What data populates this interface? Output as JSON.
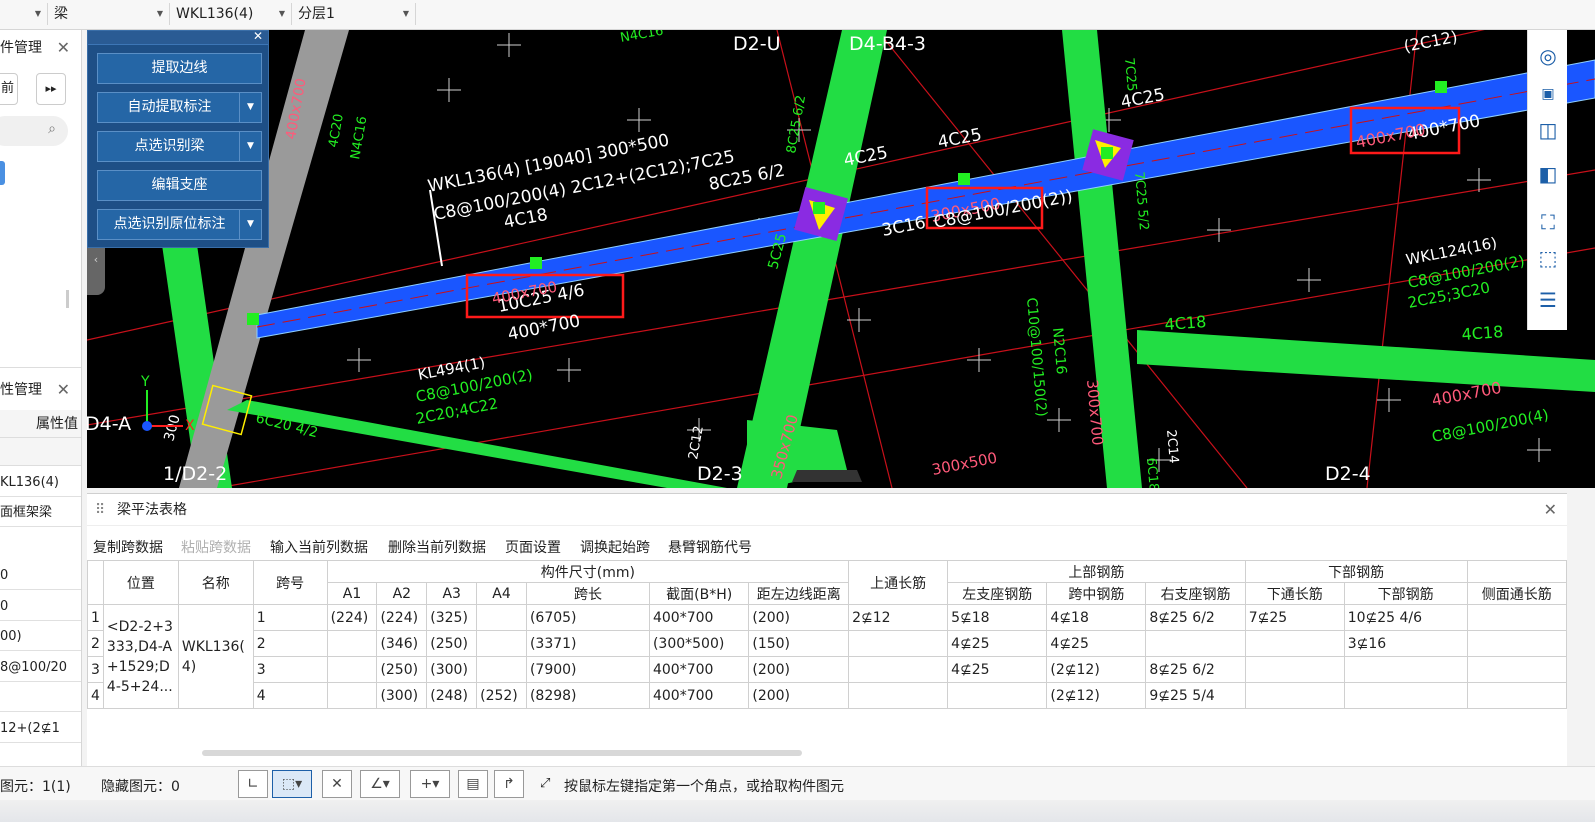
{
  "toolbar": {
    "combo1": "",
    "combo2": "梁",
    "combo3": "WKL136(4)",
    "combo4": "分层1"
  },
  "left_panel": {
    "panel1_title": "件管理",
    "panel1_btn": "前",
    "panel2_title": "性管理",
    "prop_header": "属性值",
    "rows": [
      "KL136(4)",
      "面框架梁",
      "0",
      "0",
      "00)",
      "8@100/20",
      "",
      "12+(2⊈1"
    ]
  },
  "float_tool": {
    "buttons": [
      "提取边线",
      "自动提取标注",
      "点选识别梁",
      "编辑支座",
      "点选识别原位标注"
    ]
  },
  "canvas": {
    "axis_labels": [
      "D2-U",
      "D4-B4-3",
      "D4-A",
      "1/D2-2",
      "D2-3",
      "D2-4"
    ],
    "annotations": [
      "WKL136(4) [19040] 300*500",
      "C8@100/200(4) 2C12+(2C12);7C25",
      "4C18",
      "8C25 6/2",
      "4C25",
      "4C25",
      "4C25",
      "(2C12)",
      "400*700",
      "400x700",
      "300x500",
      "C8@100/200(2))",
      "3C16",
      "10C25 4/6",
      "400*700",
      "400x700",
      "WKL124(16)",
      "C8@100/200(2)",
      "2C25;3C20",
      "KL494(1)",
      "C8@100/200(2)",
      "2C20;4C22",
      "4C18",
      "4C18",
      "400x700",
      "C8@100/200(4)",
      "300x500",
      "350x700",
      "5C25",
      "300x700",
      "C10@100/150(2)",
      "N2C16",
      "6C20 4/2",
      "400x700",
      "4C20",
      "N4C16",
      "N4C16",
      "2C14",
      "2C12",
      "6C18",
      "7C25",
      "7C25 5/2",
      "8C25 6/2",
      "300"
    ],
    "coord": [
      "Y",
      "X"
    ]
  },
  "table_panel": {
    "title": "梁平法表格",
    "toolbar": [
      {
        "label": "复制跨数据",
        "enabled": true
      },
      {
        "label": "粘贴跨数据",
        "enabled": false
      },
      {
        "label": "输入当前列数据",
        "enabled": true
      },
      {
        "label": "删除当前列数据",
        "enabled": true
      },
      {
        "label": "页面设置",
        "enabled": true
      },
      {
        "label": "调换起始跨",
        "enabled": true
      },
      {
        "label": "悬臂钢筋代号",
        "enabled": true
      }
    ],
    "group_headers": {
      "position": "位置",
      "name": "名称",
      "span": "跨号",
      "dims": "构件尺寸(mm)",
      "top_through": "上通长筋",
      "top_rebar": "上部钢筋",
      "bottom_rebar": "下部钢筋",
      "side": "侧面通长筋"
    },
    "sub_headers": [
      "A1",
      "A2",
      "A3",
      "A4",
      "跨长",
      "截面(B*H)",
      "距左边线距离",
      "左支座钢筋",
      "跨中钢筋",
      "右支座钢筋",
      "下通长筋",
      "下部钢筋"
    ],
    "row_numbers": [
      "1",
      "2",
      "3",
      "4"
    ],
    "position_text": [
      "<D2-2+3",
      "333,D4-A",
      "+1529;D",
      "4-5+24..."
    ],
    "name_text": [
      "WKL136(",
      "4)"
    ],
    "rows": [
      {
        "span": "1",
        "a1": "(224)",
        "a2": "(224)",
        "a3": "(325)",
        "a4": "",
        "len": "(6705)",
        "sec": "400*700",
        "dist": "(200)",
        "top": "2⊈12",
        "left": "5⊈18",
        "mid": "4⊈18",
        "right": "8⊈25 6/2",
        "btm_through": "7⊈25",
        "btm": "10⊈25 4/6",
        "side": ""
      },
      {
        "span": "2",
        "a1": "",
        "a2": "(346)",
        "a3": "(250)",
        "a4": "",
        "len": "(3371)",
        "sec": "(300*500)",
        "dist": "(150)",
        "top": "",
        "left": "4⊈25",
        "mid": "4⊈25",
        "right": "",
        "btm_through": "",
        "btm": "3⊈16",
        "side": ""
      },
      {
        "span": "3",
        "a1": "",
        "a2": "(250)",
        "a3": "(300)",
        "a4": "",
        "len": "(7900)",
        "sec": "400*700",
        "dist": "(200)",
        "top": "",
        "left": "4⊈25",
        "mid": "(2⊈12)",
        "right": "8⊈25 6/2",
        "btm_through": "",
        "btm": "",
        "side": ""
      },
      {
        "span": "4",
        "a1": "",
        "a2": "(300)",
        "a3": "(248)",
        "a4": "(252)",
        "len": "(8298)",
        "sec": "400*700",
        "dist": "(200)",
        "top": "",
        "left": "",
        "mid": "(2⊈12)",
        "right": "9⊈25 5/4",
        "btm_through": "",
        "btm": "",
        "side": ""
      }
    ]
  },
  "status_bar": {
    "selected": "图元：1(1)",
    "hidden": "隐藏图元：0",
    "hint": "按鼠标左键指定第一个角点，或拾取构件图元"
  },
  "colors": {
    "canvas_bg": "#000000",
    "beam_blue": "#1a56ff",
    "beam_green": "#22dd44",
    "highlight_red": "#ff1a1a",
    "panel_blue": "#1e4f86"
  }
}
